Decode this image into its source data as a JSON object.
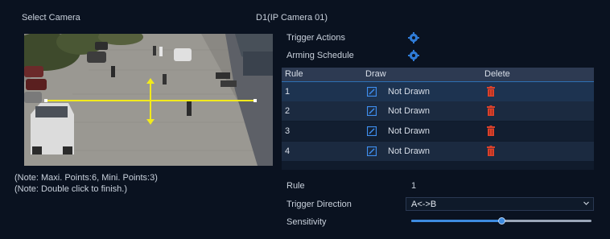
{
  "header": {
    "select_camera_label": "Select Camera",
    "camera_name": "D1(IP Camera 01)"
  },
  "settings": {
    "trigger_actions_label": "Trigger Actions",
    "arming_schedule_label": "Arming Schedule",
    "trigger_actions_icon": "gear-icon",
    "arming_schedule_icon": "gear-icon"
  },
  "rules_table": {
    "columns": [
      "Rule",
      "Draw",
      "Delete"
    ],
    "rows": [
      {
        "rule": "1",
        "draw_icon": "edit-icon",
        "status": "Not Drawn",
        "delete_icon": "trash-icon"
      },
      {
        "rule": "2",
        "draw_icon": "edit-icon",
        "status": "Not Drawn",
        "delete_icon": "trash-icon"
      },
      {
        "rule": "3",
        "draw_icon": "edit-icon",
        "status": "Not Drawn",
        "delete_icon": "trash-icon"
      },
      {
        "rule": "4",
        "draw_icon": "edit-icon",
        "status": "Not Drawn",
        "delete_icon": "trash-icon"
      }
    ],
    "selected_row": "1"
  },
  "notes": {
    "points": "(Note: Maxi. Points:6, Mini. Points:3)",
    "finish": "(Note: Double click to finish.)"
  },
  "form": {
    "rule_label": "Rule",
    "rule_value": "1",
    "trigger_direction_label": "Trigger Direction",
    "trigger_direction_value": "A<->B",
    "sensitivity_label": "Sensitivity",
    "sensitivity_value": 0.5
  },
  "colors": {
    "accent": "#3d8be0",
    "delete_icon": "#d9412b",
    "tripwire": "#f2ea1c"
  }
}
